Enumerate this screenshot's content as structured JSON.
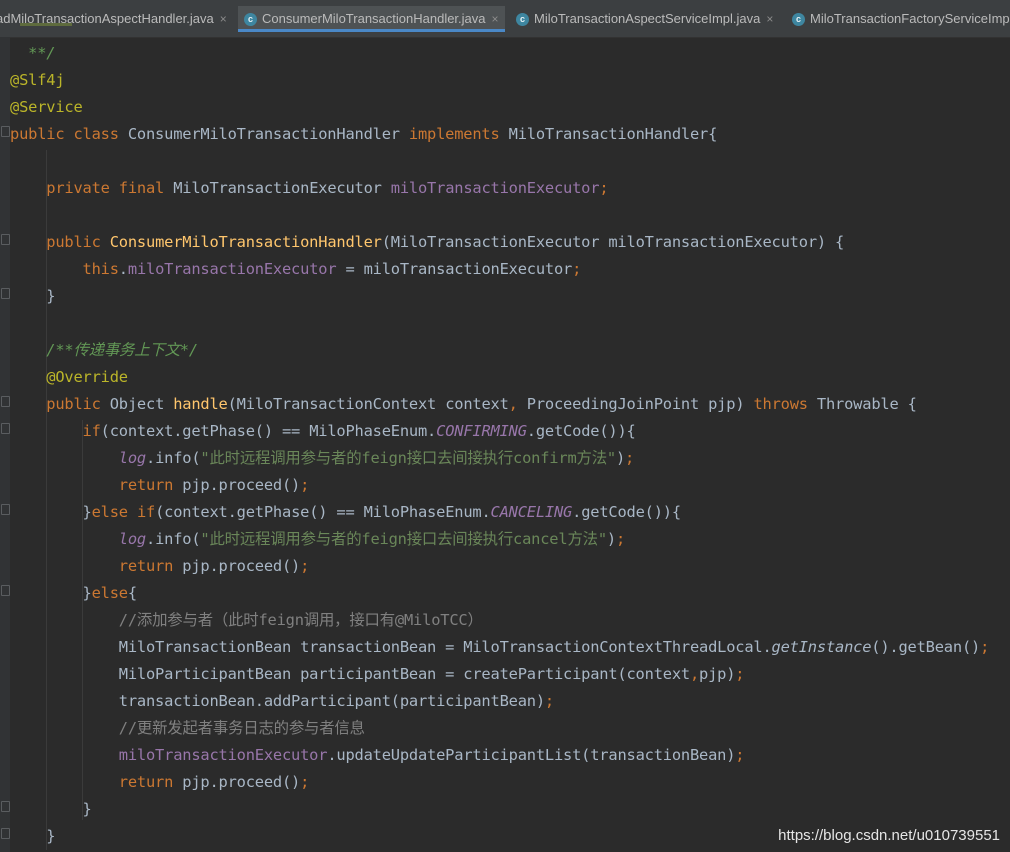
{
  "tabs": [
    {
      "label": "adMiloTransactionAspectHandler.java",
      "active": false,
      "closable": true
    },
    {
      "label": "ConsumerMiloTransactionHandler.java",
      "active": true,
      "closable": true
    },
    {
      "label": "MiloTransactionAspectServiceImpl.java",
      "active": false,
      "closable": true
    },
    {
      "label": "MiloTransactionFactoryServiceImp",
      "active": false,
      "closable": false
    }
  ],
  "close_glyph": "×",
  "class_icon_glyph": "c",
  "code": {
    "l0": "**/",
    "l1": "@Slf4j",
    "l2": "@Service",
    "l3a": "public class ",
    "l3b": "ConsumerMiloTransactionHandler ",
    "l3c": "implements ",
    "l3d": "MiloTransactionHandler{",
    "l5a": "private final ",
    "l5b": "MiloTransactionExecutor ",
    "l5c": "miloTransactionExecutor",
    "l5d": ";",
    "l7a": "public ",
    "l7b": "ConsumerMiloTransactionHandler",
    "l7c": "(MiloTransactionExecutor miloTransactionExecutor) {",
    "l8a": "this",
    "l8b": ".",
    "l8c": "miloTransactionExecutor",
    "l8d": " = miloTransactionExecutor",
    "l8e": ";",
    "l9": "}",
    "l11": "/**传递事务上下文*/",
    "l12": "@Override",
    "l13a": "public ",
    "l13b": "Object ",
    "l13c": "handle",
    "l13d": "(MiloTransactionContext context",
    "l13e": ", ",
    "l13f": "ProceedingJoinPoint pjp) ",
    "l13g": "throws ",
    "l13h": "Throwable {",
    "l14a": "if",
    "l14b": "(context.getPhase() == MiloPhaseEnum.",
    "l14c": "CONFIRMING",
    "l14d": ".getCode()){",
    "l15a": "log",
    "l15b": ".info(",
    "l15c": "\"此时远程调用参与者的feign接口去间接执行confirm方法\"",
    "l15d": ")",
    "l15e": ";",
    "l16a": "return ",
    "l16b": "pjp.proceed()",
    "l16c": ";",
    "l17a": "}",
    "l17b": "else if",
    "l17c": "(context.getPhase() == MiloPhaseEnum.",
    "l17d": "CANCELING",
    "l17e": ".getCode()){",
    "l18a": "log",
    "l18b": ".info(",
    "l18c": "\"此时远程调用参与者的feign接口去间接执行cancel方法\"",
    "l18d": ")",
    "l18e": ";",
    "l19a": "return ",
    "l19b": "pjp.proceed()",
    "l19c": ";",
    "l20a": "}",
    "l20b": "else",
    "l20c": "{",
    "l21": "//添加参与者（此时feign调用，接口有@MiloTCC）",
    "l22a": "MiloTransactionBean transactionBean = MiloTransactionContextThreadLocal.",
    "l22b": "getInstance",
    "l22c": "().getBean()",
    "l22d": ";",
    "l23a": "MiloParticipantBean participantBean = createParticipant(context",
    "l23b": ",",
    "l23c": "pjp)",
    "l23d": ";",
    "l24a": "transactionBean.addParticipant(participantBean)",
    "l24b": ";",
    "l25": "//更新发起者事务日志的参与者信息",
    "l26a": "miloTransactionExecutor",
    "l26b": ".updateUpdateParticipantList(transactionBean)",
    "l26c": ";",
    "l27a": "return ",
    "l27b": "pjp.proceed()",
    "l27c": ";",
    "l28": "}",
    "l29": "}"
  },
  "watermark": "https://blog.csdn.net/u010739551",
  "colors": {
    "background": "#2b2b2b",
    "keyword": "#cc7832",
    "annotation": "#bbb529",
    "field": "#9876aa",
    "string": "#6a8759",
    "comment": "#808080",
    "method_decl": "#ffc66d",
    "tab_underline": "#4a88c7"
  }
}
